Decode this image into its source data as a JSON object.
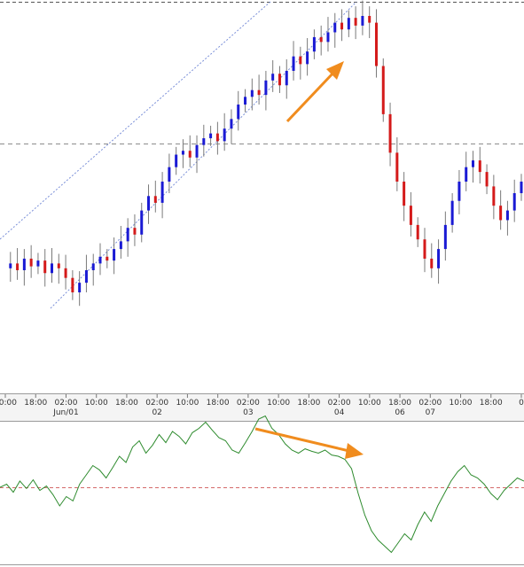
{
  "chart_data": [
    {
      "type": "candlestick",
      "x_axis": {
        "ticks": [
          {
            "label": "00:00",
            "date_label": ""
          },
          {
            "label": "18:00",
            "date_label": ""
          },
          {
            "label": "02:00",
            "date_label": "Jun/01"
          },
          {
            "label": "10:00",
            "date_label": ""
          },
          {
            "label": "18:00",
            "date_label": ""
          },
          {
            "label": "02:00",
            "date_label": "02"
          },
          {
            "label": "10:00",
            "date_label": ""
          },
          {
            "label": "18:00",
            "date_label": ""
          },
          {
            "label": "02:00",
            "date_label": "03"
          },
          {
            "label": "10:00",
            "date_label": ""
          },
          {
            "label": "18:00",
            "date_label": ""
          },
          {
            "label": "02:00",
            "date_label": "04"
          },
          {
            "label": "10:00",
            "date_label": ""
          },
          {
            "label": "18:00",
            "date_label": "06"
          },
          {
            "label": "02:00",
            "date_label": "07"
          },
          {
            "label": "10:00",
            "date_label": ""
          },
          {
            "label": "18:00",
            "date_label": ""
          },
          {
            "label": "0",
            "date_label": ""
          }
        ]
      },
      "price_path_relative": [
        0.5,
        0.55,
        0.48,
        0.6,
        0.52,
        0.58,
        0.45,
        0.55,
        0.5,
        0.4,
        0.25,
        0.35,
        0.48,
        0.55,
        0.62,
        0.58,
        0.7,
        0.78,
        0.92,
        0.85,
        1.1,
        1.25,
        1.18,
        1.4,
        1.55,
        1.68,
        1.72,
        1.65,
        1.78,
        1.85,
        1.9,
        1.82,
        1.95,
        2.05,
        2.2,
        2.28,
        2.35,
        2.3,
        2.45,
        2.52,
        2.4,
        2.55,
        2.7,
        2.62,
        2.75,
        2.9,
        2.85,
        2.95,
        3.05,
        2.98,
        3.1,
        3.02,
        3.12,
        3.05,
        2.6,
        2.1,
        1.7,
        1.4,
        1.15,
        0.95,
        0.8,
        0.6,
        0.5,
        0.7,
        0.95,
        1.2,
        1.4,
        1.55,
        1.62,
        1.5,
        1.35,
        1.15,
        1.0,
        1.1,
        1.28,
        1.4
      ],
      "overlays": {
        "upward_channel": true,
        "horizontal_reference_lines": 2,
        "arrow_annotation_up": true
      },
      "colors": {
        "bullish": "#1a1ad4",
        "bearish": "#d41a1a",
        "wick": "#7a7a7a",
        "channel": "#7a8fd8",
        "reference": "#8c8c8c",
        "arrow": "#f08c1e"
      }
    },
    {
      "type": "line",
      "description_panel": "oscillator",
      "series": [
        {
          "values": [
            0.0,
            0.05,
            -0.08,
            0.1,
            -0.02,
            0.12,
            -0.05,
            0.02,
            -0.12,
            -0.3,
            -0.15,
            -0.22,
            0.05,
            0.2,
            0.35,
            0.28,
            0.15,
            0.32,
            0.5,
            0.4,
            0.65,
            0.75,
            0.55,
            0.68,
            0.85,
            0.72,
            0.9,
            0.82,
            0.7,
            0.88,
            0.95,
            1.05,
            0.92,
            0.8,
            0.75,
            0.6,
            0.55,
            0.72,
            0.9,
            1.1,
            1.15,
            0.95,
            0.85,
            0.7,
            0.6,
            0.55,
            0.62,
            0.58,
            0.55,
            0.6,
            0.52,
            0.5,
            0.45,
            0.3,
            -0.1,
            -0.45,
            -0.7,
            -0.85,
            -0.95,
            -1.05,
            -0.9,
            -0.75,
            -0.85,
            -0.6,
            -0.4,
            -0.55,
            -0.3,
            -0.1,
            0.1,
            0.25,
            0.35,
            0.2,
            0.15,
            0.05,
            -0.1,
            -0.2,
            -0.05,
            0.05,
            0.15,
            0.1
          ]
        }
      ],
      "reference_line": 0,
      "colors": {
        "line": "#2e8b2e",
        "reference": "#d46a6a",
        "arrow": "#f08c1e"
      }
    }
  ]
}
